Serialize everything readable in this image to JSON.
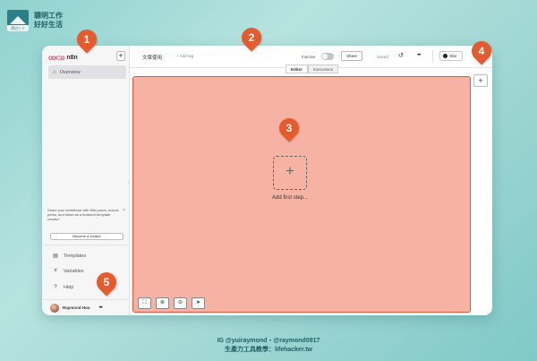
{
  "brand": {
    "logo_caption": "漂泊三十",
    "line1": "聰明工作",
    "line2": "好好生活"
  },
  "sidebar": {
    "logo_text": "n8n",
    "add_button": "+",
    "overview_label": "Overview",
    "promo_text": "Share your workflows with N8n users, unlock perks, and shine as a featured template creator!",
    "promo_close": "×",
    "creator_button": "Become a creator",
    "items": [
      {
        "label": "Templates"
      },
      {
        "label": "Variables"
      },
      {
        "label": "Help"
      }
    ],
    "user_name": "Raymond Hou",
    "user_more": "•••"
  },
  "header": {
    "workflow_name": "文章使用",
    "add_tag": "+ Add tag",
    "inactive_label": "Inactive",
    "share_label": "Share",
    "saved_label": "Saved",
    "more_label": "•••",
    "star_label": "Star"
  },
  "tabs": [
    {
      "label": "Editor"
    },
    {
      "label": "Executions"
    }
  ],
  "canvas": {
    "add_step_symbol": "+",
    "add_step_label": "Add first step...",
    "plus_button": "+"
  },
  "markers": [
    "1",
    "2",
    "3",
    "4",
    "5"
  ],
  "footer": {
    "line1": "IG @yuiraymond・@raymond0917",
    "line2": "生產力工具教學：lifehacker.tw"
  },
  "colors": {
    "accent": "#e65b2d",
    "canvas_highlight": "#f6b3a4",
    "brand": "#ea4b71"
  }
}
